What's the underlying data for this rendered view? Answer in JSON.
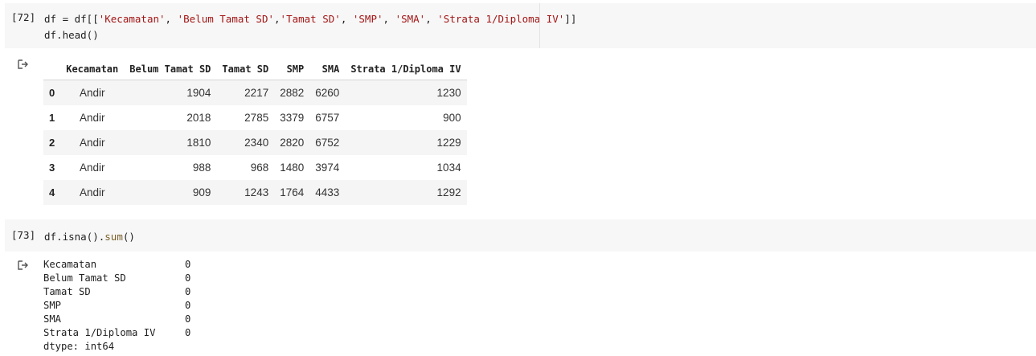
{
  "cell1": {
    "prompt": "[72]",
    "line1_a": "df = df[[",
    "line1_strs": [
      "'Kecamatan'",
      "'Belum Tamat SD'",
      "'Tamat SD'",
      "'SMP'",
      "'SMA'",
      "'Strata 1/Diploma IV'"
    ],
    "line1_end": "]]",
    "line2": "df.head()"
  },
  "table": {
    "columns": [
      "",
      "Kecamatan",
      "Belum Tamat SD",
      "Tamat SD",
      "SMP",
      "SMA",
      "Strata 1/Diploma IV"
    ],
    "rows": [
      {
        "idx": "0",
        "kec": "Andir",
        "belum": "1904",
        "tamat": "2217",
        "smp": "2882",
        "sma": "6260",
        "strata": "1230"
      },
      {
        "idx": "1",
        "kec": "Andir",
        "belum": "2018",
        "tamat": "2785",
        "smp": "3379",
        "sma": "6757",
        "strata": "900"
      },
      {
        "idx": "2",
        "kec": "Andir",
        "belum": "1810",
        "tamat": "2340",
        "smp": "2820",
        "sma": "6752",
        "strata": "1229"
      },
      {
        "idx": "3",
        "kec": "Andir",
        "belum": "988",
        "tamat": "968",
        "smp": "1480",
        "sma": "3974",
        "strata": "1034"
      },
      {
        "idx": "4",
        "kec": "Andir",
        "belum": "909",
        "tamat": "1243",
        "smp": "1764",
        "sma": "4433",
        "strata": "1292"
      }
    ]
  },
  "cell2": {
    "prompt": "[73]",
    "code_a": "df.isna().",
    "code_fn": "sum",
    "code_b": "()"
  },
  "output2": {
    "items": [
      {
        "label": "Kecamatan",
        "value": "0"
      },
      {
        "label": "Belum Tamat SD",
        "value": "0"
      },
      {
        "label": "Tamat SD",
        "value": "0"
      },
      {
        "label": "SMP",
        "value": "0"
      },
      {
        "label": "SMA",
        "value": "0"
      },
      {
        "label": "Strata 1/Diploma IV",
        "value": "0"
      }
    ],
    "dtype": "dtype: int64"
  },
  "icons": {
    "output": "output-arrow-icon"
  }
}
